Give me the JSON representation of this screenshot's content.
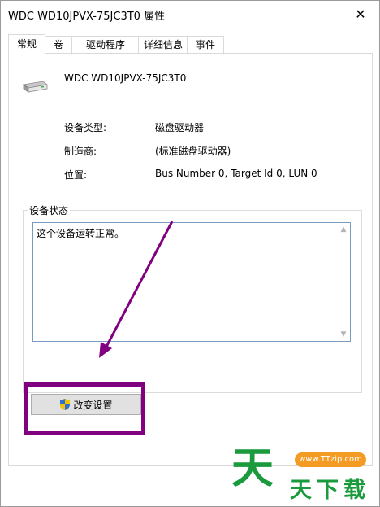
{
  "window": {
    "title": "WDC WD10JPVX-75JC3T0 属性",
    "close_glyph": "✕"
  },
  "tabs": [
    {
      "label": "常规",
      "active": true
    },
    {
      "label": "卷",
      "active": false
    },
    {
      "label": "驱动程序",
      "active": false
    },
    {
      "label": "详细信息",
      "active": false
    },
    {
      "label": "事件",
      "active": false
    }
  ],
  "device": {
    "icon": "disk-drive-icon",
    "name": "WDC WD10JPVX-75JC3T0"
  },
  "properties": [
    {
      "label": "设备类型:",
      "value": "磁盘驱动器"
    },
    {
      "label": "制造商:",
      "value": "(标准磁盘驱动器)"
    },
    {
      "label": "位置:",
      "value": "Bus Number 0, Target Id 0, LUN 0"
    }
  ],
  "device_status": {
    "title": "设备状态",
    "text": "这个设备运转正常。"
  },
  "change_settings_button": {
    "label": "改变设置",
    "icon": "uac-shield-icon"
  },
  "annotation": {
    "color": "#800080"
  },
  "watermark": {
    "url": "www.TTzip.com",
    "big_char": "天",
    "small_text": "天下载",
    "color": "#1a9a3c",
    "url_color": "#f39b22"
  }
}
